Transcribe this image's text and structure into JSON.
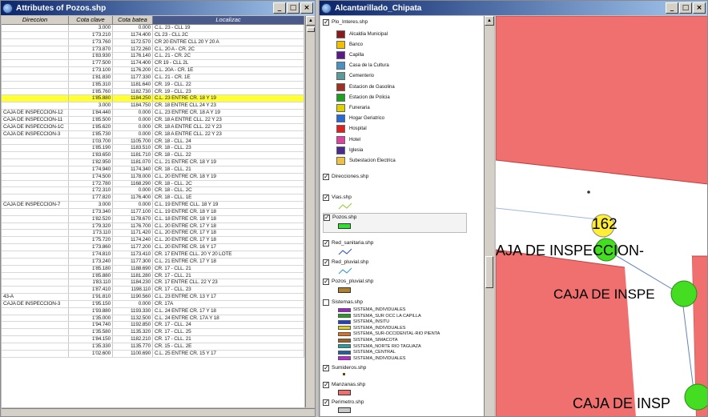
{
  "left_window": {
    "title": "Attributes of Pozos.shp",
    "columns": [
      "Direccion",
      "Cota clave",
      "Cota batea",
      "Localizac"
    ],
    "rows": [
      {
        "dir": "",
        "clave": "3.000",
        "batea": "0.000",
        "loc": "C.L. 23 - CLL 19"
      },
      {
        "dir": "",
        "clave": "1'73.210",
        "batea": "1174.400",
        "loc": "CL 23 - CLL 2C"
      },
      {
        "dir": "",
        "clave": "1'73.760",
        "batea": "1172.570",
        "loc": "CR 20 ENTRE CLL 20 Y 20 A"
      },
      {
        "dir": "",
        "clave": "1'73.870",
        "batea": "1172.260",
        "loc": "C.L. 20 A - CR. 2C"
      },
      {
        "dir": "",
        "clave": "1'83.930",
        "batea": "1176.140",
        "loc": "C.L. 21 - CR. 2C"
      },
      {
        "dir": "",
        "clave": "1'77.500",
        "batea": "1174.400",
        "loc": "CR 19 - CLL 2L"
      },
      {
        "dir": "",
        "clave": "1'73.100",
        "batea": "1176.200",
        "loc": "C.L. 20A - CR. 1E"
      },
      {
        "dir": "",
        "clave": "1'81.830",
        "batea": "1177.330",
        "loc": "C.L. 21 - CR. 1E"
      },
      {
        "dir": "",
        "clave": "1'85.310",
        "batea": "1181.640",
        "loc": "CR. 19 - CLL. 22"
      },
      {
        "dir": "",
        "clave": "1'85.760",
        "batea": "1182.730",
        "loc": "CR. 19 - CLL. 23"
      },
      {
        "dir": "",
        "clave": "1'85.880",
        "batea": "1184.250",
        "loc": "C.L. 23 ENTRE CR. 18 Y 19",
        "hl": true
      },
      {
        "dir": "",
        "clave": "3.000",
        "batea": "1184.750",
        "loc": "CR. 18 ENTRE CLL 24 Y 23"
      },
      {
        "dir": "CAJA DE INSPECCION-12",
        "clave": "1'84.440",
        "batea": "0.000",
        "loc": "C.L. 23 ENTRE CR. 18 A Y 19"
      },
      {
        "dir": "CAJA DE INSPECCION-11",
        "clave": "1'85.500",
        "batea": "0.000",
        "loc": "CR. 18 A ENTRE CLL. 22 Y 23"
      },
      {
        "dir": "CAJA DE INSPECCION-1C",
        "clave": "1'85.620",
        "batea": "0.000",
        "loc": "CR. 18 A ENTRE CLL. 22 Y 23"
      },
      {
        "dir": "CAJA DE INSPECCION-3",
        "clave": "1'85.730",
        "batea": "0.000",
        "loc": "CR. 18 A ENTRE CLL. 22 Y 23"
      },
      {
        "dir": "",
        "clave": "1'03.700",
        "batea": "1105.700",
        "loc": "CR. 18 - CLL. 24"
      },
      {
        "dir": "",
        "clave": "1'85.190",
        "batea": "1183.510",
        "loc": "CR. 18 - CLL. 23"
      },
      {
        "dir": "",
        "clave": "1'83.650",
        "batea": "1181.710",
        "loc": "CR. 18 - CLL. 22"
      },
      {
        "dir": "",
        "clave": "1'82.950",
        "batea": "1181.070",
        "loc": "C.L. 21 ENTRE CR. 18 Y 19"
      },
      {
        "dir": "",
        "clave": "1'74.940",
        "batea": "1174.340",
        "loc": "CR. 18 - CLL. 21"
      },
      {
        "dir": "",
        "clave": "1'74.500",
        "batea": "1178.000",
        "loc": "C.L. 20 ENTRE CR. 18 Y 19"
      },
      {
        "dir": "",
        "clave": "1'72.780",
        "batea": "1168.290",
        "loc": "CR. 18 - CLL. 2C"
      },
      {
        "dir": "",
        "clave": "1'72.310",
        "batea": "0.000",
        "loc": "CR. 18 - CLL. 2C"
      },
      {
        "dir": "",
        "clave": "1'77.820",
        "batea": "1176.400",
        "loc": "CR. 18 - CLL. 1E"
      },
      {
        "dir": "CAJA DE INSPECCION-7",
        "clave": "3.000",
        "batea": "0.000",
        "loc": "C.L. 19 ENTRE CLL. 18 Y 19"
      },
      {
        "dir": "",
        "clave": "1'73.340",
        "batea": "1177.100",
        "loc": "C.L. 19 ENTRE CR. 18 Y 18"
      },
      {
        "dir": "",
        "clave": "1'82.520",
        "batea": "1178.670",
        "loc": "C.L. 18 ENTRE CR. 18 Y 18"
      },
      {
        "dir": "",
        "clave": "1'79.320",
        "batea": "1176.700",
        "loc": "C.L. 20 ENTRE CR. 17 Y 18"
      },
      {
        "dir": "",
        "clave": "1'73.110",
        "batea": "1171.420",
        "loc": "C.L. 20 ENTRE CR. 17 Y 18"
      },
      {
        "dir": "",
        "clave": "1'75.720",
        "batea": "1174.240",
        "loc": "C.L. 20 ENTRE CR. 17 Y 18"
      },
      {
        "dir": "",
        "clave": "1'73.860",
        "batea": "1177.200",
        "loc": "C.L. 20 ENTRE CR. 16 Y 17"
      },
      {
        "dir": "",
        "clave": "1'74.810",
        "batea": "1173.410",
        "loc": "CR. 17 ENTRE CLL. 20 Y 20 LOTE"
      },
      {
        "dir": "",
        "clave": "1'73.240",
        "batea": "1177.300",
        "loc": "C.L. 21 ENTRE CR. 17 Y 18"
      },
      {
        "dir": "",
        "clave": "1'85.180",
        "batea": "1188.690",
        "loc": "CR. 17 - CLL. 21"
      },
      {
        "dir": "",
        "clave": "1'85.880",
        "batea": "1181.280",
        "loc": "CR. 17 - CLL. 21"
      },
      {
        "dir": "",
        "clave": "1'83.110",
        "batea": "1184.230",
        "loc": "CR. 17 ENTRE CLL. 22 Y 23"
      },
      {
        "dir": "",
        "clave": "1'87.410",
        "batea": "1198.110",
        "loc": "CR. 17 - CLL. 23"
      },
      {
        "dir": "43-A",
        "clave": "1'91.810",
        "batea": "1190.560",
        "loc": "C.L. 23 ENTRE CR. 13 Y 17"
      },
      {
        "dir": "CAJA DE INSPECCION-3",
        "clave": "1'95.150",
        "batea": "0.000",
        "loc": "CR. 17A"
      },
      {
        "dir": "",
        "clave": "1'93.880",
        "batea": "1193.330",
        "loc": "C.L. 24 ENTRE CR. 17 Y 18"
      },
      {
        "dir": "",
        "clave": "1'35.000",
        "batea": "1132.500",
        "loc": "C.L. 24 ENTRE CR. 17A Y 18"
      },
      {
        "dir": "",
        "clave": "1'94.740",
        "batea": "1192.850",
        "loc": "CR. 17 - CLL. 24"
      },
      {
        "dir": "",
        "clave": "1'35.580",
        "batea": "1135.320",
        "loc": "CR. 17 - CLL. 25"
      },
      {
        "dir": "",
        "clave": "1'84.150",
        "batea": "1182.210",
        "loc": "CR. 17 - CLL. 21"
      },
      {
        "dir": "",
        "clave": "1'35.330",
        "batea": "1135.770",
        "loc": "CR. 15 - CLL. 2E"
      },
      {
        "dir": "",
        "clave": "1'02.600",
        "batea": "1100.690",
        "loc": "C.L. 25 ENTRE CR. 15 Y 17"
      }
    ]
  },
  "right_window": {
    "title": "Alcantarillado_Chipata",
    "layers": [
      {
        "name": "Plo_Interes.shp"
      },
      {
        "name": "Direcciones.shp"
      },
      {
        "name": "Vias.shp"
      },
      {
        "name": "Pozos.shp"
      },
      {
        "name": "Red_sanitaria.shp"
      },
      {
        "name": "Red_pluvial.shp"
      },
      {
        "name": "Pozos_pluvial.shp"
      },
      {
        "name": "Sistemas.shp"
      },
      {
        "name": "Sumideros.shp"
      },
      {
        "name": "Manzanas.shp"
      },
      {
        "name": "Perimetro.shp"
      }
    ],
    "poi_items": [
      {
        "label": "Alcaldia Municipal",
        "color": "#8b1a1a"
      },
      {
        "label": "Banco",
        "color": "#f0c000"
      },
      {
        "label": "Capilla",
        "color": "#5a1a8a"
      },
      {
        "label": "Casa de la Cultura",
        "color": "#4a90c0"
      },
      {
        "label": "Cementerio",
        "color": "#5a9a9a"
      },
      {
        "label": "Estacion de Gasolina",
        "color": "#a03020"
      },
      {
        "label": "Estacion de Policia",
        "color": "#20a020"
      },
      {
        "label": "Funeraria",
        "color": "#e0d000"
      },
      {
        "label": "Hogar Geriatrico",
        "color": "#2a6ad0"
      },
      {
        "label": "Hospital",
        "color": "#e02020"
      },
      {
        "label": "Hotel",
        "color": "#e040a0"
      },
      {
        "label": "Iglesia",
        "color": "#4a2a8a"
      },
      {
        "label": "Subestacion Electrica",
        "color": "#f0c040"
      }
    ],
    "sistemas": [
      {
        "label": "SISTEMA_INDIVIDUALES",
        "color": "#a020d0"
      },
      {
        "label": "SISTEMA_SUR OCC LA CAPILLA",
        "color": "#20a020"
      },
      {
        "label": "SISTEMA_INSITU",
        "color": "#2040d0"
      },
      {
        "label": "SISTEMA_INDIVIDUALES",
        "color": "#e0d020"
      },
      {
        "label": "SISTEMA_SUR-OCCIDENTAL-RIO PIENTA",
        "color": "#e07020"
      },
      {
        "label": "SISTEMA_SIMACOTA",
        "color": "#a06020"
      },
      {
        "label": "SISTEMA_NORTE RIO TAGUAZA",
        "color": "#20a0a0"
      },
      {
        "label": "SISTEMA_CENTRAL",
        "color": "#2060a0"
      },
      {
        "label": "SISTEMA_INDIVIDUALES",
        "color": "#c020e0"
      }
    ],
    "map_labels": {
      "node_number": "162",
      "caja1": "AJA DE INSPECCION-",
      "caja2": "CAJA DE INSPE",
      "caja3": "CAJA DE INSP"
    }
  }
}
